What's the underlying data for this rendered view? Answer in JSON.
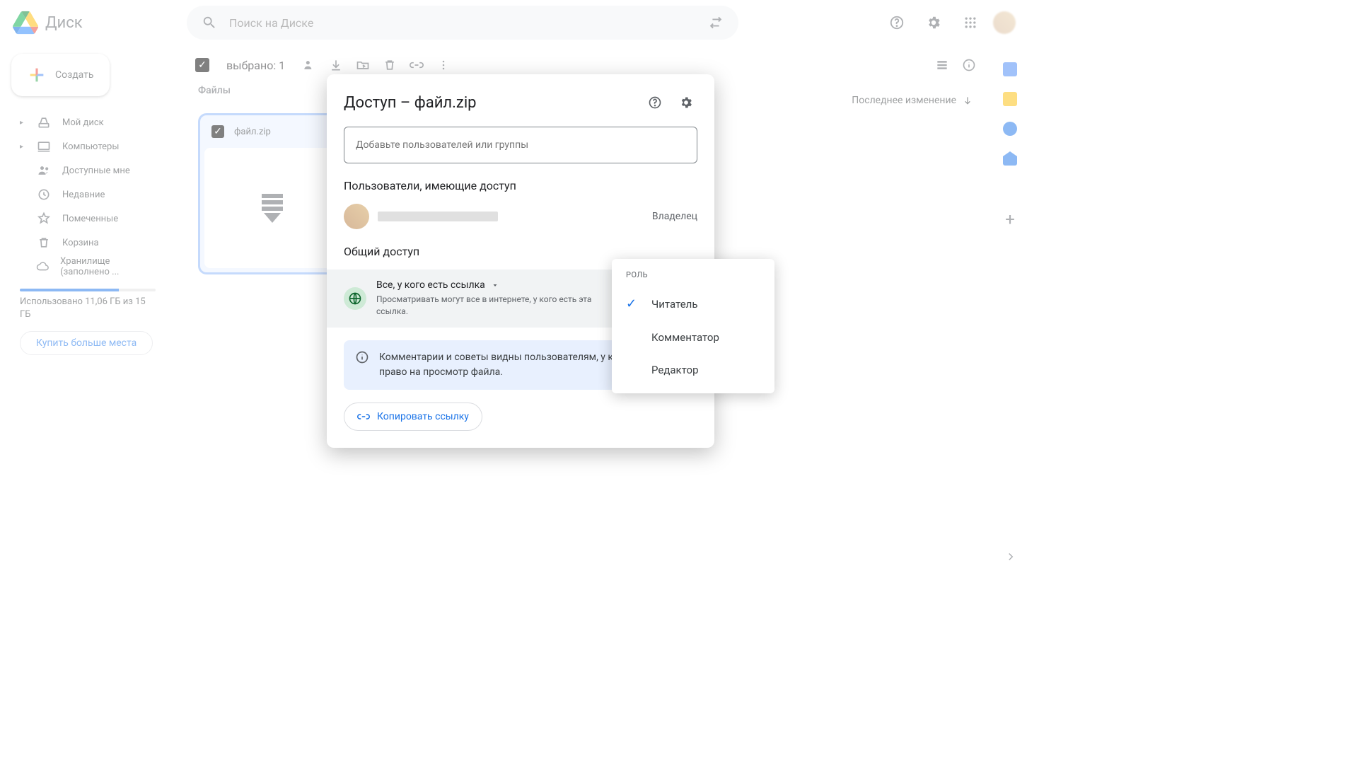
{
  "app": {
    "name": "Диск"
  },
  "search": {
    "placeholder": "Поиск на Диске"
  },
  "create_button": "Создать",
  "nav": {
    "items": [
      {
        "label": "Мой диск",
        "expandable": true
      },
      {
        "label": "Компьютеры",
        "expandable": true
      },
      {
        "label": "Доступные мне",
        "expandable": false
      },
      {
        "label": "Недавние",
        "expandable": false
      },
      {
        "label": "Помеченные",
        "expandable": false
      },
      {
        "label": "Корзина",
        "expandable": false
      },
      {
        "label": "Хранилище (заполнено ...",
        "expandable": false
      }
    ]
  },
  "storage": {
    "text": "Использовано 11,06 ГБ из 15 ГБ",
    "buy": "Купить больше места"
  },
  "toolbar": {
    "selected": "выбрано: 1"
  },
  "files": {
    "heading": "Файлы"
  },
  "sort": {
    "label": "Последнее изменение"
  },
  "file": {
    "name": "файл.zip"
  },
  "modal": {
    "title": "Доступ – файл.zip",
    "add_placeholder": "Добавьте пользователей или группы",
    "users_heading": "Пользователи, имеющие доступ",
    "owner_role": "Владелец",
    "general_heading": "Общий доступ",
    "link_scope": "Все, у кого есть ссылка",
    "link_desc": "Просматривать могут все в интернете, у кого есть эта ссылка.",
    "role_current": "Читатель",
    "info": "Комментарии и советы видны пользователям, у которых есть право на просмотр файла.",
    "copy": "Копировать ссылку"
  },
  "dropdown": {
    "label": "РОЛЬ",
    "options": [
      "Читатель",
      "Комментатор",
      "Редактор"
    ],
    "selected_index": 0
  }
}
